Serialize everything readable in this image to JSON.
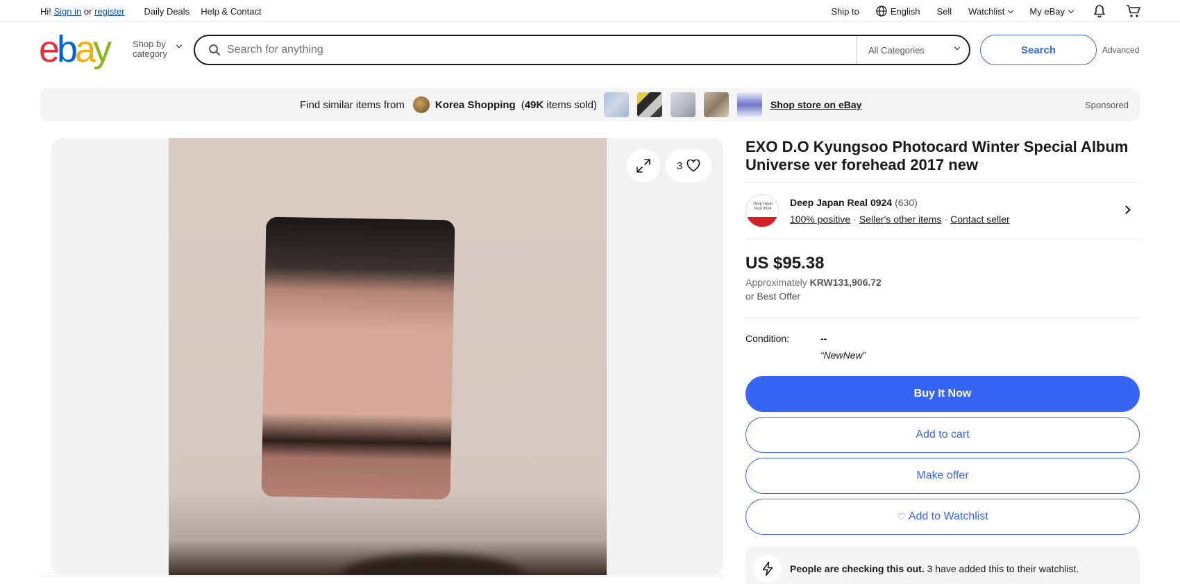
{
  "topbar": {
    "greeting": "Hi!",
    "sign_in": "Sign in",
    "or": "or",
    "register": "register",
    "daily_deals": "Daily Deals",
    "help_contact": "Help & Contact",
    "ship_to": "Ship to",
    "language": "English",
    "sell": "Sell",
    "watchlist": "Watchlist",
    "my_ebay": "My eBay"
  },
  "header": {
    "logo": {
      "e": "e",
      "b": "b",
      "a": "a",
      "y": "y"
    },
    "shop_by": "Shop by",
    "category": "category",
    "search_placeholder": "Search for anything",
    "all_categories": "All Categories",
    "search_button": "Search",
    "advanced": "Advanced"
  },
  "banner": {
    "find_similar": "Find similar items from",
    "store_name": "Korea Shopping",
    "sold_count": "49K",
    "sold_suffix": "items sold)",
    "shop_store": "Shop store on eBay",
    "sponsored": "Sponsored"
  },
  "gallery": {
    "like_count": "3"
  },
  "item": {
    "title": "EXO D.O Kyungsoo Photocard Winter Special Album Universe ver forehead 2017 new",
    "seller": {
      "name": "Deep Japan Real 0924",
      "feedback_count": "(630)",
      "avatar_text": "Deep Japan Real 0924",
      "positive": "100% positive",
      "other_items": "Seller's other items",
      "contact": "Contact seller"
    },
    "price": "US $95.38",
    "approx_label": "Approximately",
    "approx_value": "KRW131,906.72",
    "best_offer": "or Best Offer",
    "condition_label": "Condition:",
    "condition_value": "--",
    "condition_desc": "“NewNew”",
    "buttons": {
      "buy_now": "Buy It Now",
      "add_to_cart": "Add to cart",
      "make_offer": "Make offer",
      "add_to_watchlist": "Add to Watchlist"
    },
    "notice": {
      "bold": "People are checking this out.",
      "rest": "3 have added this to their watchlist."
    }
  },
  "colors": {
    "accent": "#3665f3",
    "link": "#0654ba",
    "logo_e": "#e53238",
    "logo_b": "#0064d2",
    "logo_a": "#f5af02",
    "logo_y": "#86b817"
  },
  "icons": [
    "globe-icon",
    "bell-icon",
    "cart-icon",
    "search-icon",
    "expand-icon",
    "heart-icon",
    "chevron-right-icon",
    "lightning-icon"
  ]
}
